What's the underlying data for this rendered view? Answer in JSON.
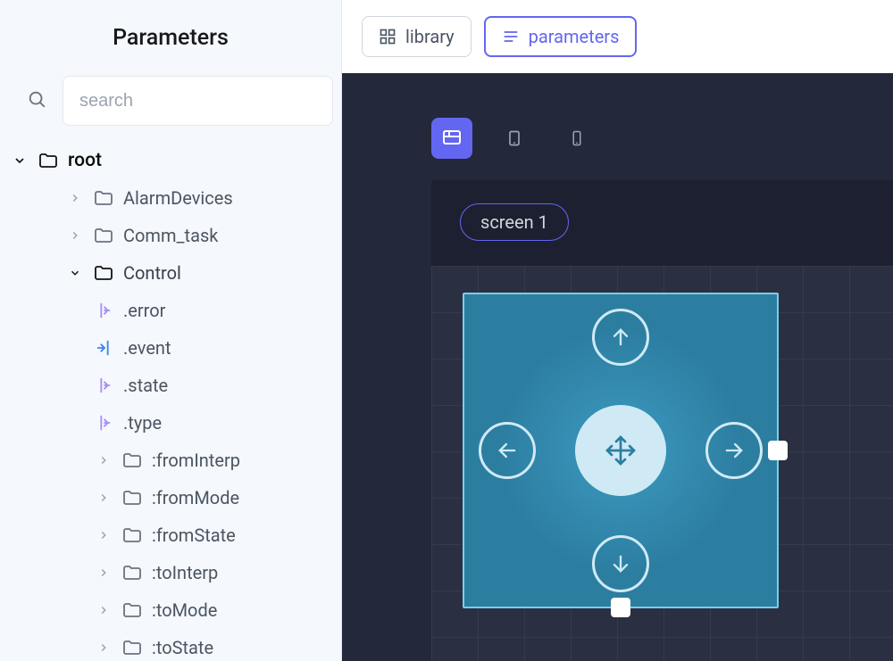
{
  "sidebar": {
    "title": "Parameters",
    "search_placeholder": "search",
    "root_label": "root",
    "collapsed": [
      {
        "label": "AlarmDevices"
      },
      {
        "label": "Comm_task"
      }
    ],
    "control": {
      "label": "Control",
      "params": [
        {
          "label": ".error",
          "dir": "output"
        },
        {
          "label": ".event",
          "dir": "input"
        },
        {
          "label": ".state",
          "dir": "output"
        },
        {
          "label": ".type",
          "dir": "output"
        }
      ],
      "children": [
        {
          "label": ":fromInterp"
        },
        {
          "label": ":fromMode"
        },
        {
          "label": ":fromState"
        },
        {
          "label": ":toInterp"
        },
        {
          "label": ":toMode"
        },
        {
          "label": ":toState"
        }
      ]
    }
  },
  "toolbar": {
    "library_label": "library",
    "parameters_label": "parameters"
  },
  "canvas": {
    "screen_label": "screen 1"
  }
}
